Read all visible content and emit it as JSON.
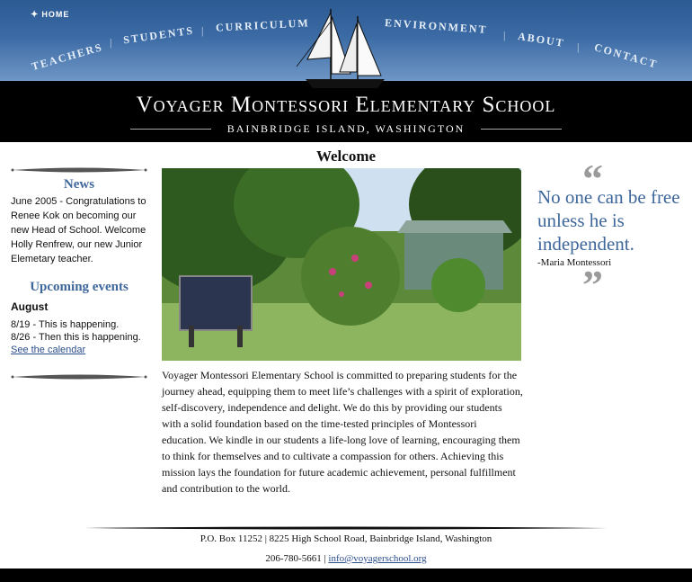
{
  "nav": {
    "home": "Home",
    "items": [
      "Teachers",
      "Students",
      "Curriculum",
      "Environment",
      "About",
      "Contact"
    ]
  },
  "school": {
    "name": "Voyager Montessori Elementary School",
    "location": "Bainbridge Island, Washington"
  },
  "main": {
    "heading": "Welcome",
    "body": "Voyager Montessori Elementary School is committed to preparing students for the journey ahead, equipping them to meet life’s challenges with a spirit of exploration, self-discovery, independence and delight. We do this by providing our students with a solid foundation based on the time-tested principles of Montessori education. We kindle in our students a life-long love of learning, encouraging them to think for themselves and to cultivate a compassion for others. Achieving this mission lays the foundation for future academic achievement, personal fulfillment and contribution to the world."
  },
  "sidebar": {
    "news_heading": "News",
    "news_text": "June 2005 - Congratulations to Renee Kok on becoming our new Head of School. Welcome Holly Renfrew, our new Junior Elemetary teacher.",
    "events_heading": "Upcoming events",
    "month": "August",
    "events": [
      {
        "date": "8/19",
        "text": " - This is happening."
      },
      {
        "date": "8/26",
        "text": " - Then this is happening."
      }
    ],
    "calendar_link": "See the calendar"
  },
  "quote": {
    "text": "No one can be free unless he is independent.",
    "author": "-Maria Montessori"
  },
  "footer": {
    "address": "P.O. Box 11252 | 8225 High School Road, Bainbridge Island, Washington",
    "phone": "206-780-5661",
    "separator": " | ",
    "email": "info@voyagerschool.org"
  },
  "colors": {
    "accent": "#3e679b",
    "header_blue": "#3b6aa4",
    "link": "#2a4e8a"
  }
}
